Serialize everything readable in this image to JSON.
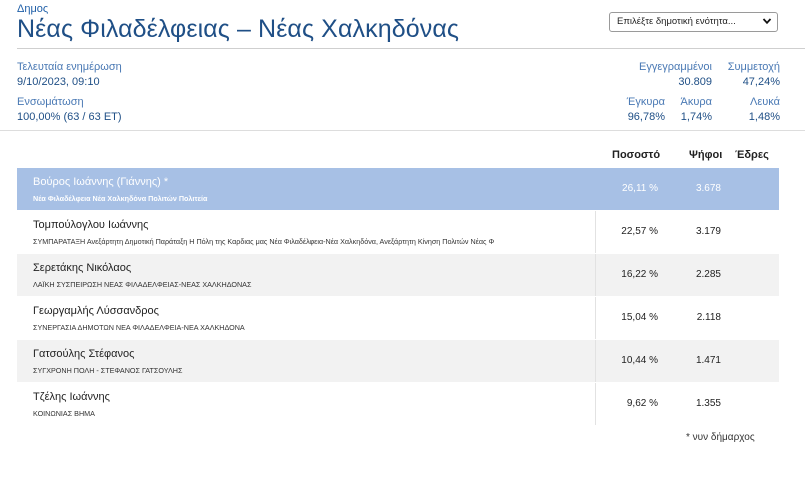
{
  "header": {
    "top_label": "Δημος",
    "title": "Νέας Φιλαδέλφειας – Νέας Χαλκηδόνας",
    "unit_select_value": "Επιλέξτε δημοτική ενότητα..."
  },
  "meta": {
    "last_update_label": "Τελευταία ενημέρωση",
    "last_update_value": "9/10/2023, 09:10",
    "integration_label": "Ενσωμάτωση",
    "integration_value": "100,00% (63 / 63 ΕΤ)"
  },
  "stats": {
    "registered_label": "Εγγεγραμμένοι",
    "registered_value": "30.809",
    "turnout_label": "Συμμετοχή",
    "turnout_value": "47,24%",
    "valid_label": "Έγκυρα",
    "valid_value": "96,78%",
    "invalid_label": "Άκυρα",
    "invalid_value": "1,74%",
    "blank_label": "Λευκά",
    "blank_value": "1,48%"
  },
  "table": {
    "headers": {
      "percent": "Ποσοστό",
      "votes": "Ψήφοι",
      "seats": "Έδρες"
    },
    "rows": [
      {
        "name": "Βούρος Ιωάννης (Γιάννης)  *",
        "party": "Νέα Φιλαδέλφεια Νέα Χαλκηδόνα Πολιτών Πολιτεία",
        "percent": "26,11 %",
        "votes": "3.678",
        "seats": ""
      },
      {
        "name": "Τομπούλογλου Ιωάννης",
        "party": "ΣΥΜΠΑΡΑΤΑΞΗ Ανεξάρτητη Δημοτική Παράταξη Η Πόλη της Καρδιας μας Νέα Φιλαδέλφεια-Νέα Χαλκηδόνα, Ανεξάρτητη Κίνηση Πολιτών Νέας Φ",
        "percent": "22,57 %",
        "votes": "3.179",
        "seats": ""
      },
      {
        "name": "Σερετάκης Νικόλαος",
        "party": "ΛΑΪΚΗ ΣΥΣΠΕΙΡΩΣΗ ΝΕΑΣ ΦΙΛΑΔΕΛΦΕΙΑΣ-ΝΕΑΣ ΧΑΛΚΗΔΟΝΑΣ",
        "percent": "16,22 %",
        "votes": "2.285",
        "seats": ""
      },
      {
        "name": "Γεωργαμλής Λύσσανδρος",
        "party": "ΣΥΝΕΡΓΑΣΙΑ ΔΗΜΟΤΩΝ ΝΕΑ ΦΙΛΑΔΕΛΦΕΙΑ-ΝΕΑ ΧΑΛΚΗΔΟΝΑ",
        "percent": "15,04 %",
        "votes": "2.118",
        "seats": ""
      },
      {
        "name": "Γατσούλης Στέφανος",
        "party": "ΣΥΓΧΡΟΝΗ ΠΟΛΗ - ΣΤΕΦΑΝΟΣ ΓΑΤΣΟΥΛΗΣ",
        "percent": "10,44 %",
        "votes": "1.471",
        "seats": ""
      },
      {
        "name": "Τζέλης Ιωάννης",
        "party": "ΚΟΙΝΩΝΙΑΣ ΒΗΜΑ",
        "percent": "9,62 %",
        "votes": "1.355",
        "seats": ""
      }
    ]
  },
  "footnote": "* νυν δήμαρχος",
  "colors": {
    "title_blue": "#1f4f86",
    "label_blue": "#4a79b4",
    "winner_row": "#a7c0e5",
    "alt_row": "#f2f2f2"
  },
  "icons": {
    "select_arrow": "chevron-down-icon"
  }
}
